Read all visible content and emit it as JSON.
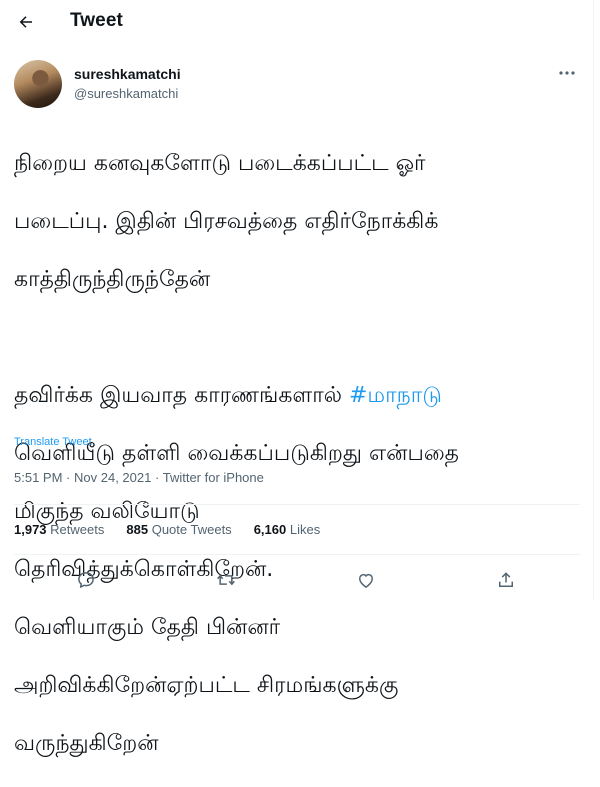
{
  "header": {
    "title": "Tweet"
  },
  "author": {
    "display_name": "sureshkamatchi",
    "handle": "@sureshkamatchi"
  },
  "tweet": {
    "lines_part1": [
      "நிறைய கனவுகளோடு படைக்கப்பட்ட ஓர்",
      "படைப்பு. இதின் பிரசவத்தை எதிர்நோக்கிக்",
      "காத்திருந்திருந்தேன்"
    ],
    "line_with_hashtag_prefix": "தவிர்க்க இயவாத காரணங்களால் ",
    "hashtag": "#மாநாடு",
    "lines_part2": [
      "வெளியீடு தள்ளி வைக்கப்படுகிறது என்பதை",
      "மிகுந்த வலியோடு",
      "தெரிவித்துக்கொள்கிறேன்.",
      "வெளியாகும் தேதி பின்னர்",
      "அறிவிக்கிறேன்ஏற்பட்ட சிரமங்களுக்கு",
      "வருந்துகிறேன்"
    ],
    "translate_label": "Translate Tweet",
    "time": "5:51 PM",
    "separator": "·",
    "date": "Nov 24, 2021",
    "source": "Twitter for iPhone"
  },
  "stats": {
    "retweets_count": "1,973",
    "retweets_label": "Retweets",
    "quotes_count": "885",
    "quotes_label": "Quote Tweets",
    "likes_count": "6,160",
    "likes_label": "Likes"
  },
  "icons": {
    "back": "arrow-left-icon",
    "more": "more-horizontal-icon",
    "reply": "reply-icon",
    "retweet": "retweet-icon",
    "like": "heart-icon",
    "share": "share-icon"
  },
  "colors": {
    "accent": "#1d9bf0",
    "text": "#0f1419",
    "secondary": "#536471",
    "divider": "#eff3f4"
  }
}
